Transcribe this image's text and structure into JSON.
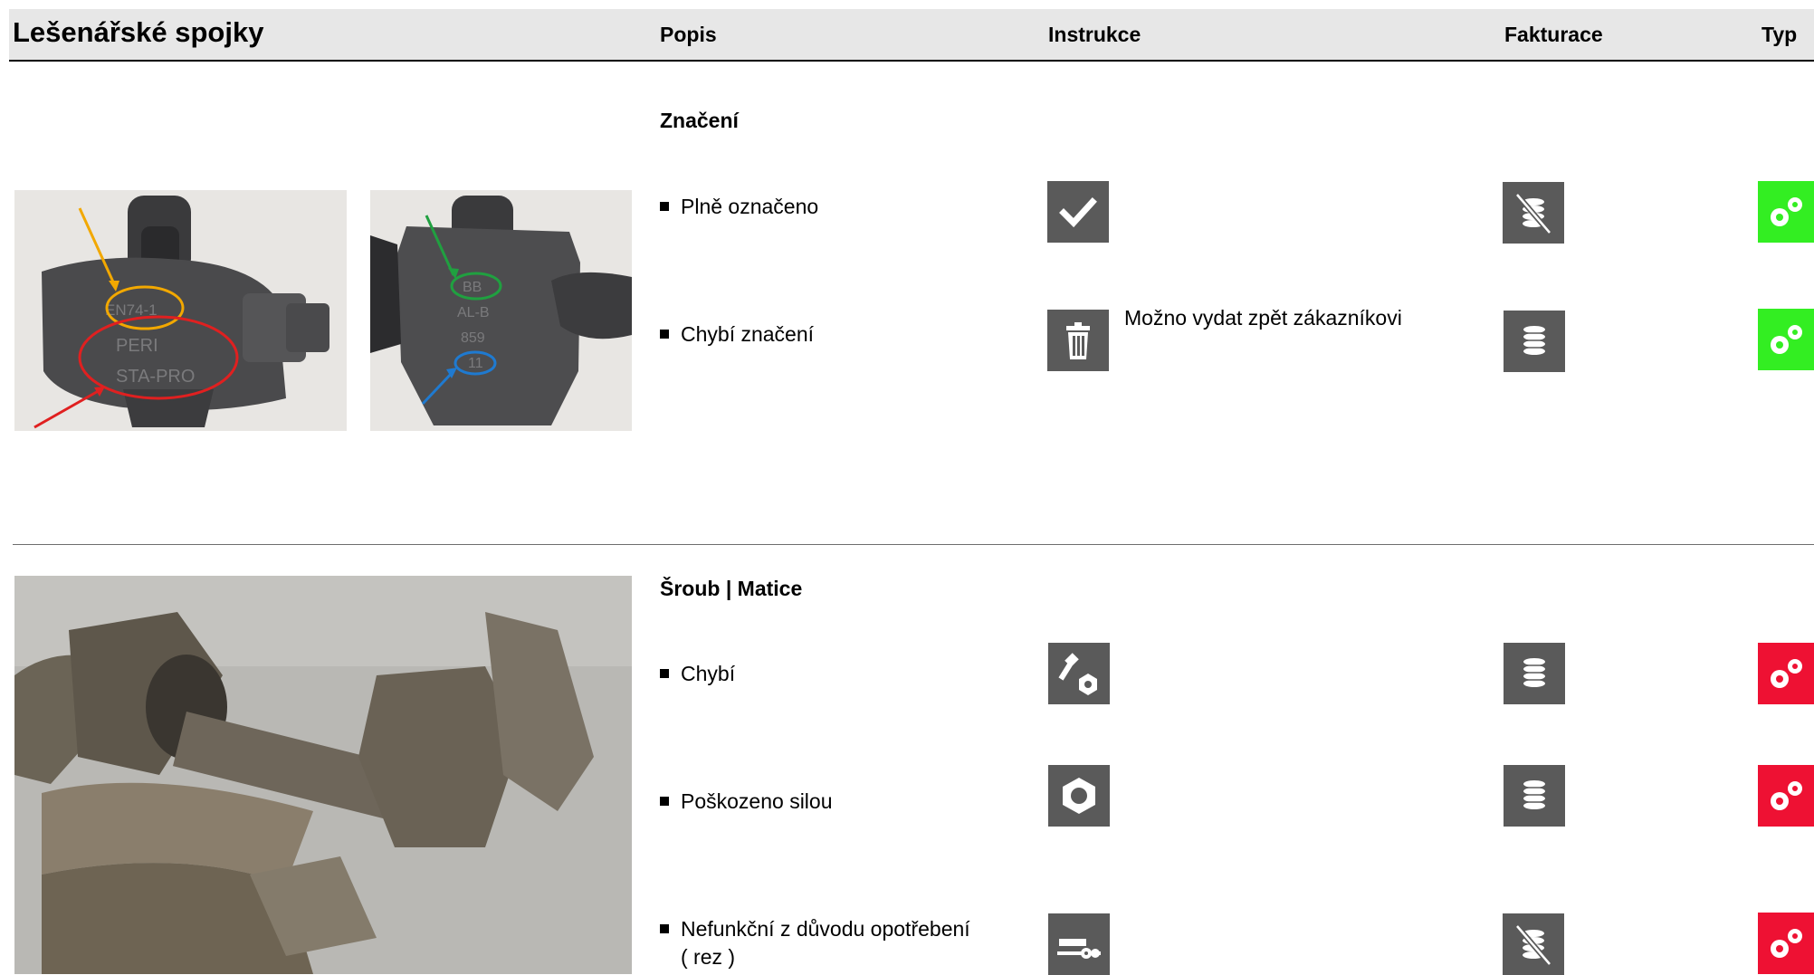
{
  "header": {
    "title": "Lešenářské spojky",
    "columns": {
      "popis": "Popis",
      "instrukce": "Instrukce",
      "fakturace": "Fakturace",
      "typ": "Typ"
    }
  },
  "colors": {
    "header_bg": "#e7e7e7",
    "icon_bg": "#5a5a5a",
    "type_green": "#33ee22",
    "type_red": "#ee1133"
  },
  "sections": [
    {
      "title": "Značení",
      "photo_labels": [
        "EN74-1",
        "PERI",
        "STA-PRO",
        "BB",
        "AL-B",
        "859",
        "11"
      ],
      "items": [
        {
          "label": "Plně označeno",
          "instruction_icon": "checkmark-icon",
          "billing_icon": "no-billing-icon",
          "type": "green"
        },
        {
          "label": "Chybí značení",
          "instruction_icon": "trash-icon",
          "instruction_note": "Možno vydat zpět zákazníkovi",
          "billing_icon": "billing-icon",
          "type": "green"
        }
      ]
    },
    {
      "title": "Šroub | Matice",
      "items": [
        {
          "label": "Chybí",
          "instruction_icon": "bolt-nut-icon",
          "billing_icon": "billing-icon",
          "type": "red"
        },
        {
          "label": "Poškozeno silou",
          "instruction_icon": "nut-icon",
          "billing_icon": "billing-icon",
          "type": "red"
        },
        {
          "label": "Nefunkční z důvodu opotřebení",
          "label_line2": "( rez )",
          "instruction_icon": "rust-wear-icon",
          "billing_icon": "no-billing-icon",
          "type": "red"
        }
      ]
    }
  ]
}
